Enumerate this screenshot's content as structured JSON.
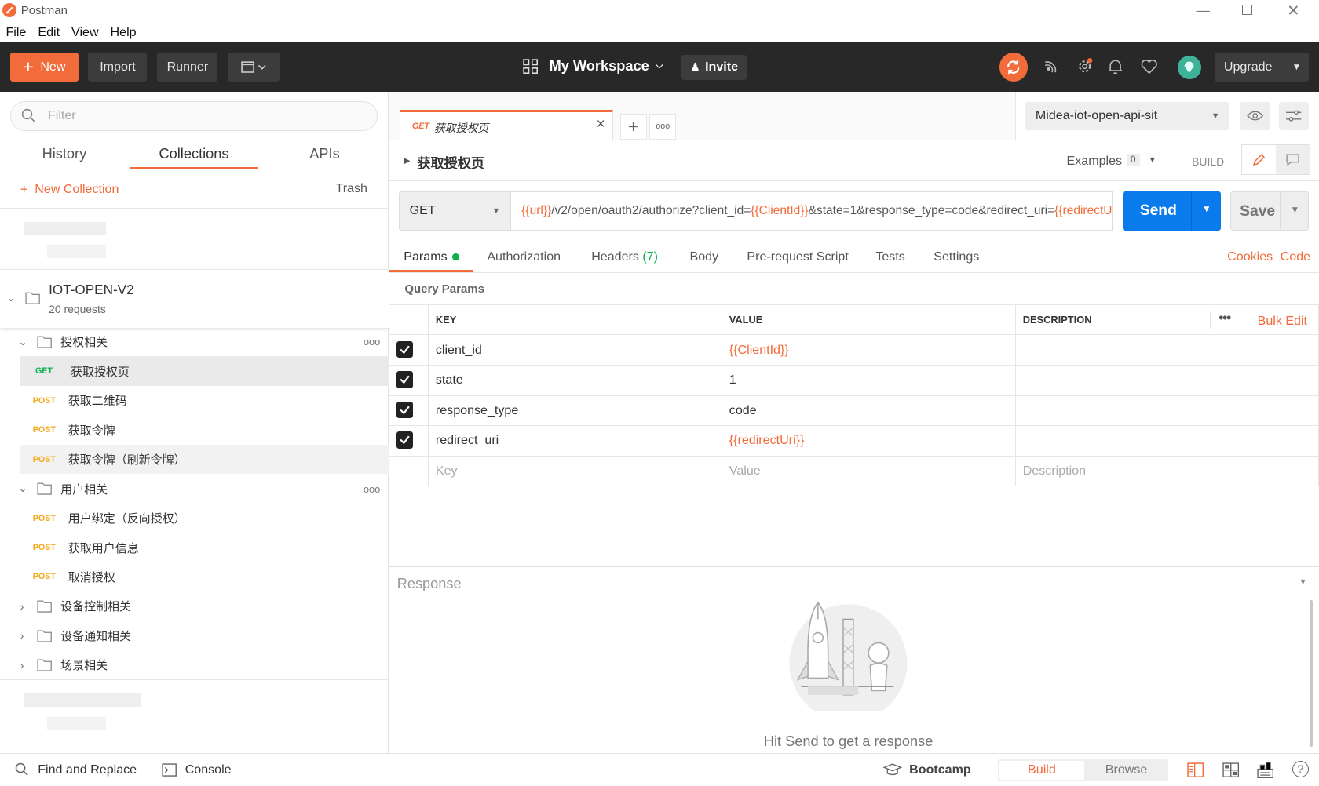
{
  "window": {
    "title": "Postman"
  },
  "menu": [
    "File",
    "Edit",
    "View",
    "Help"
  ],
  "header": {
    "new_label": "New",
    "import_label": "Import",
    "runner_label": "Runner",
    "workspace_label": "My Workspace",
    "invite_label": "Invite",
    "upgrade_label": "Upgrade"
  },
  "sidebar": {
    "filter_placeholder": "Filter",
    "tabs": [
      "History",
      "Collections",
      "APIs"
    ],
    "active_tab": "Collections",
    "new_collection_label": "New Collection",
    "trash_label": "Trash",
    "collection": {
      "name": "IOT-OPEN-V2",
      "count": "20 requests"
    },
    "items": [
      {
        "type": "folder",
        "label": "授权相关",
        "expanded": true
      },
      {
        "type": "request",
        "method": "GET",
        "label": "获取授权页",
        "selected": true
      },
      {
        "type": "request",
        "method": "POST",
        "label": "获取二维码"
      },
      {
        "type": "request",
        "method": "POST",
        "label": "获取令牌"
      },
      {
        "type": "request",
        "method": "POST",
        "label": "获取令牌（刷新令牌）"
      },
      {
        "type": "folder",
        "label": "用户相关",
        "expanded": true
      },
      {
        "type": "request",
        "method": "POST",
        "label": "用户绑定（反向授权）"
      },
      {
        "type": "request",
        "method": "POST",
        "label": "获取用户信息"
      },
      {
        "type": "request",
        "method": "POST",
        "label": "取消授权"
      },
      {
        "type": "folder",
        "label": "设备控制相关",
        "expanded": false
      },
      {
        "type": "folder",
        "label": "设备通知相关",
        "expanded": false
      },
      {
        "type": "folder",
        "label": "场景相关",
        "expanded": false
      }
    ]
  },
  "request_tab": {
    "method": "GET",
    "title": "获取授权页"
  },
  "environment": {
    "selected": "Midea-iot-open-api-sit"
  },
  "request": {
    "name": "获取授权页",
    "examples_label": "Examples",
    "examples_count": "0",
    "build_label": "BUILD",
    "method": "GET",
    "url_parts": [
      {
        "text": "{{url}}",
        "var": true
      },
      {
        "text": "/v2/open/oauth2/authorize?client_id=",
        "var": false
      },
      {
        "text": "{{ClientId}}",
        "var": true
      },
      {
        "text": "&state=1&response_type=code&redirect_uri=",
        "var": false
      },
      {
        "text": "{{redirectUri}}",
        "var": true
      }
    ],
    "send_label": "Send",
    "save_label": "Save"
  },
  "subtabs": [
    {
      "label": "Params",
      "active": true
    },
    {
      "label": "Authorization"
    },
    {
      "label": "Headers",
      "count": "(7)"
    },
    {
      "label": "Body"
    },
    {
      "label": "Pre-request Script"
    },
    {
      "label": "Tests"
    },
    {
      "label": "Settings"
    }
  ],
  "cookies_label": "Cookies",
  "code_label": "Code",
  "query_params": {
    "title": "Query Params",
    "columns": [
      "KEY",
      "VALUE",
      "DESCRIPTION"
    ],
    "bulk_edit_label": "Bulk Edit",
    "rows": [
      {
        "key": "client_id",
        "value": "{{ClientId}}",
        "var": true
      },
      {
        "key": "state",
        "value": "1",
        "var": false
      },
      {
        "key": "response_type",
        "value": "code",
        "var": false
      },
      {
        "key": "redirect_uri",
        "value": "{{redirectUri}}",
        "var": true
      }
    ],
    "placeholders": {
      "key": "Key",
      "value": "Value",
      "description": "Description"
    }
  },
  "response": {
    "title": "Response",
    "empty_message": "Hit Send to get a response"
  },
  "footer": {
    "find_replace_label": "Find and Replace",
    "console_label": "Console",
    "bootcamp_label": "Bootcamp",
    "build_label": "Build",
    "browse_label": "Browse"
  },
  "colors": {
    "accent": "#f26b3a",
    "send": "#097bed",
    "header_bg": "#282828",
    "post": "#f4a91a",
    "get": "#0cb04d"
  }
}
